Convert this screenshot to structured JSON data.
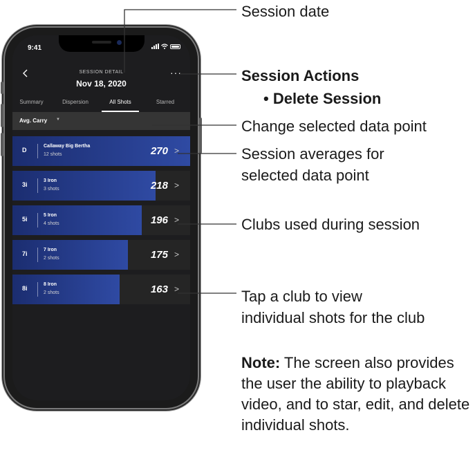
{
  "status_bar": {
    "time": "9:41"
  },
  "header": {
    "label": "SESSION DETAIL",
    "date": "Nov 18, 2020",
    "back_icon": "chevron-left-icon",
    "more_icon": "ellipsis-icon",
    "more_text": "···"
  },
  "tabs": [
    {
      "label": "Summary",
      "active": false
    },
    {
      "label": "Dispersion",
      "active": false
    },
    {
      "label": "All Shots",
      "active": true
    },
    {
      "label": "Starred",
      "active": false
    }
  ],
  "filter": {
    "label": "Avg. Carry",
    "caret": "▼"
  },
  "clubs": [
    {
      "abbr": "D",
      "name": "Callaway Big Bertha",
      "shots": "12 shots",
      "value": "270",
      "fill": 1.0
    },
    {
      "abbr": "3i",
      "name": "3 Iron",
      "shots": "3 shots",
      "value": "218",
      "fill": 0.807
    },
    {
      "abbr": "5i",
      "name": "5 Iron",
      "shots": "4 shots",
      "value": "196",
      "fill": 0.726
    },
    {
      "abbr": "7i",
      "name": "7 Iron",
      "shots": "2 shots",
      "value": "175",
      "fill": 0.648
    },
    {
      "abbr": "8i",
      "name": "8 Iron",
      "shots": "2 shots",
      "value": "163",
      "fill": 0.604
    }
  ],
  "annotations": {
    "session_date": "Session date",
    "session_actions": "Session Actions",
    "delete_session": "• Delete Session",
    "change_data_point": "Change selected data point",
    "averages_line1": "Session averages for",
    "averages_line2": "selected data point",
    "clubs_used": "Clubs used during session",
    "tap_line1": "Tap a club to view",
    "tap_line2": "individual shots for the club",
    "note_head": "Note:",
    "note_body": " The screen also provides the user the ability to playback video, and to star, edit, and delete individual shots."
  },
  "colors": {
    "bar": "#2f4aa3",
    "background": "#1d1d1f",
    "filter_bar": "#353535"
  }
}
